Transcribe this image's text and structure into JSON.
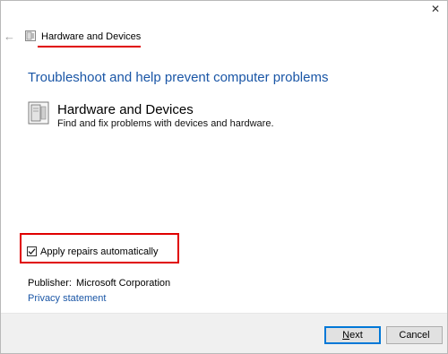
{
  "window": {
    "close_glyph": "✕",
    "back_glyph": "←",
    "title": "Hardware and Devices",
    "title_icon": "troubleshooter-icon",
    "accent_red": "#e00000",
    "link_color": "#1a56a6"
  },
  "main": {
    "heading": "Troubleshoot and help prevent computer problems",
    "tool": {
      "icon": "hardware-devices-icon",
      "name": "Hardware and Devices",
      "description": "Find and fix problems with devices and hardware."
    },
    "apply_repairs": {
      "label": "Apply repairs automatically",
      "checked": true
    },
    "publisher_label": "Publisher:",
    "publisher_value": "Microsoft Corporation",
    "privacy_link": "Privacy statement"
  },
  "footer": {
    "next_first": "N",
    "next_rest": "ext",
    "cancel_label": "Cancel"
  }
}
